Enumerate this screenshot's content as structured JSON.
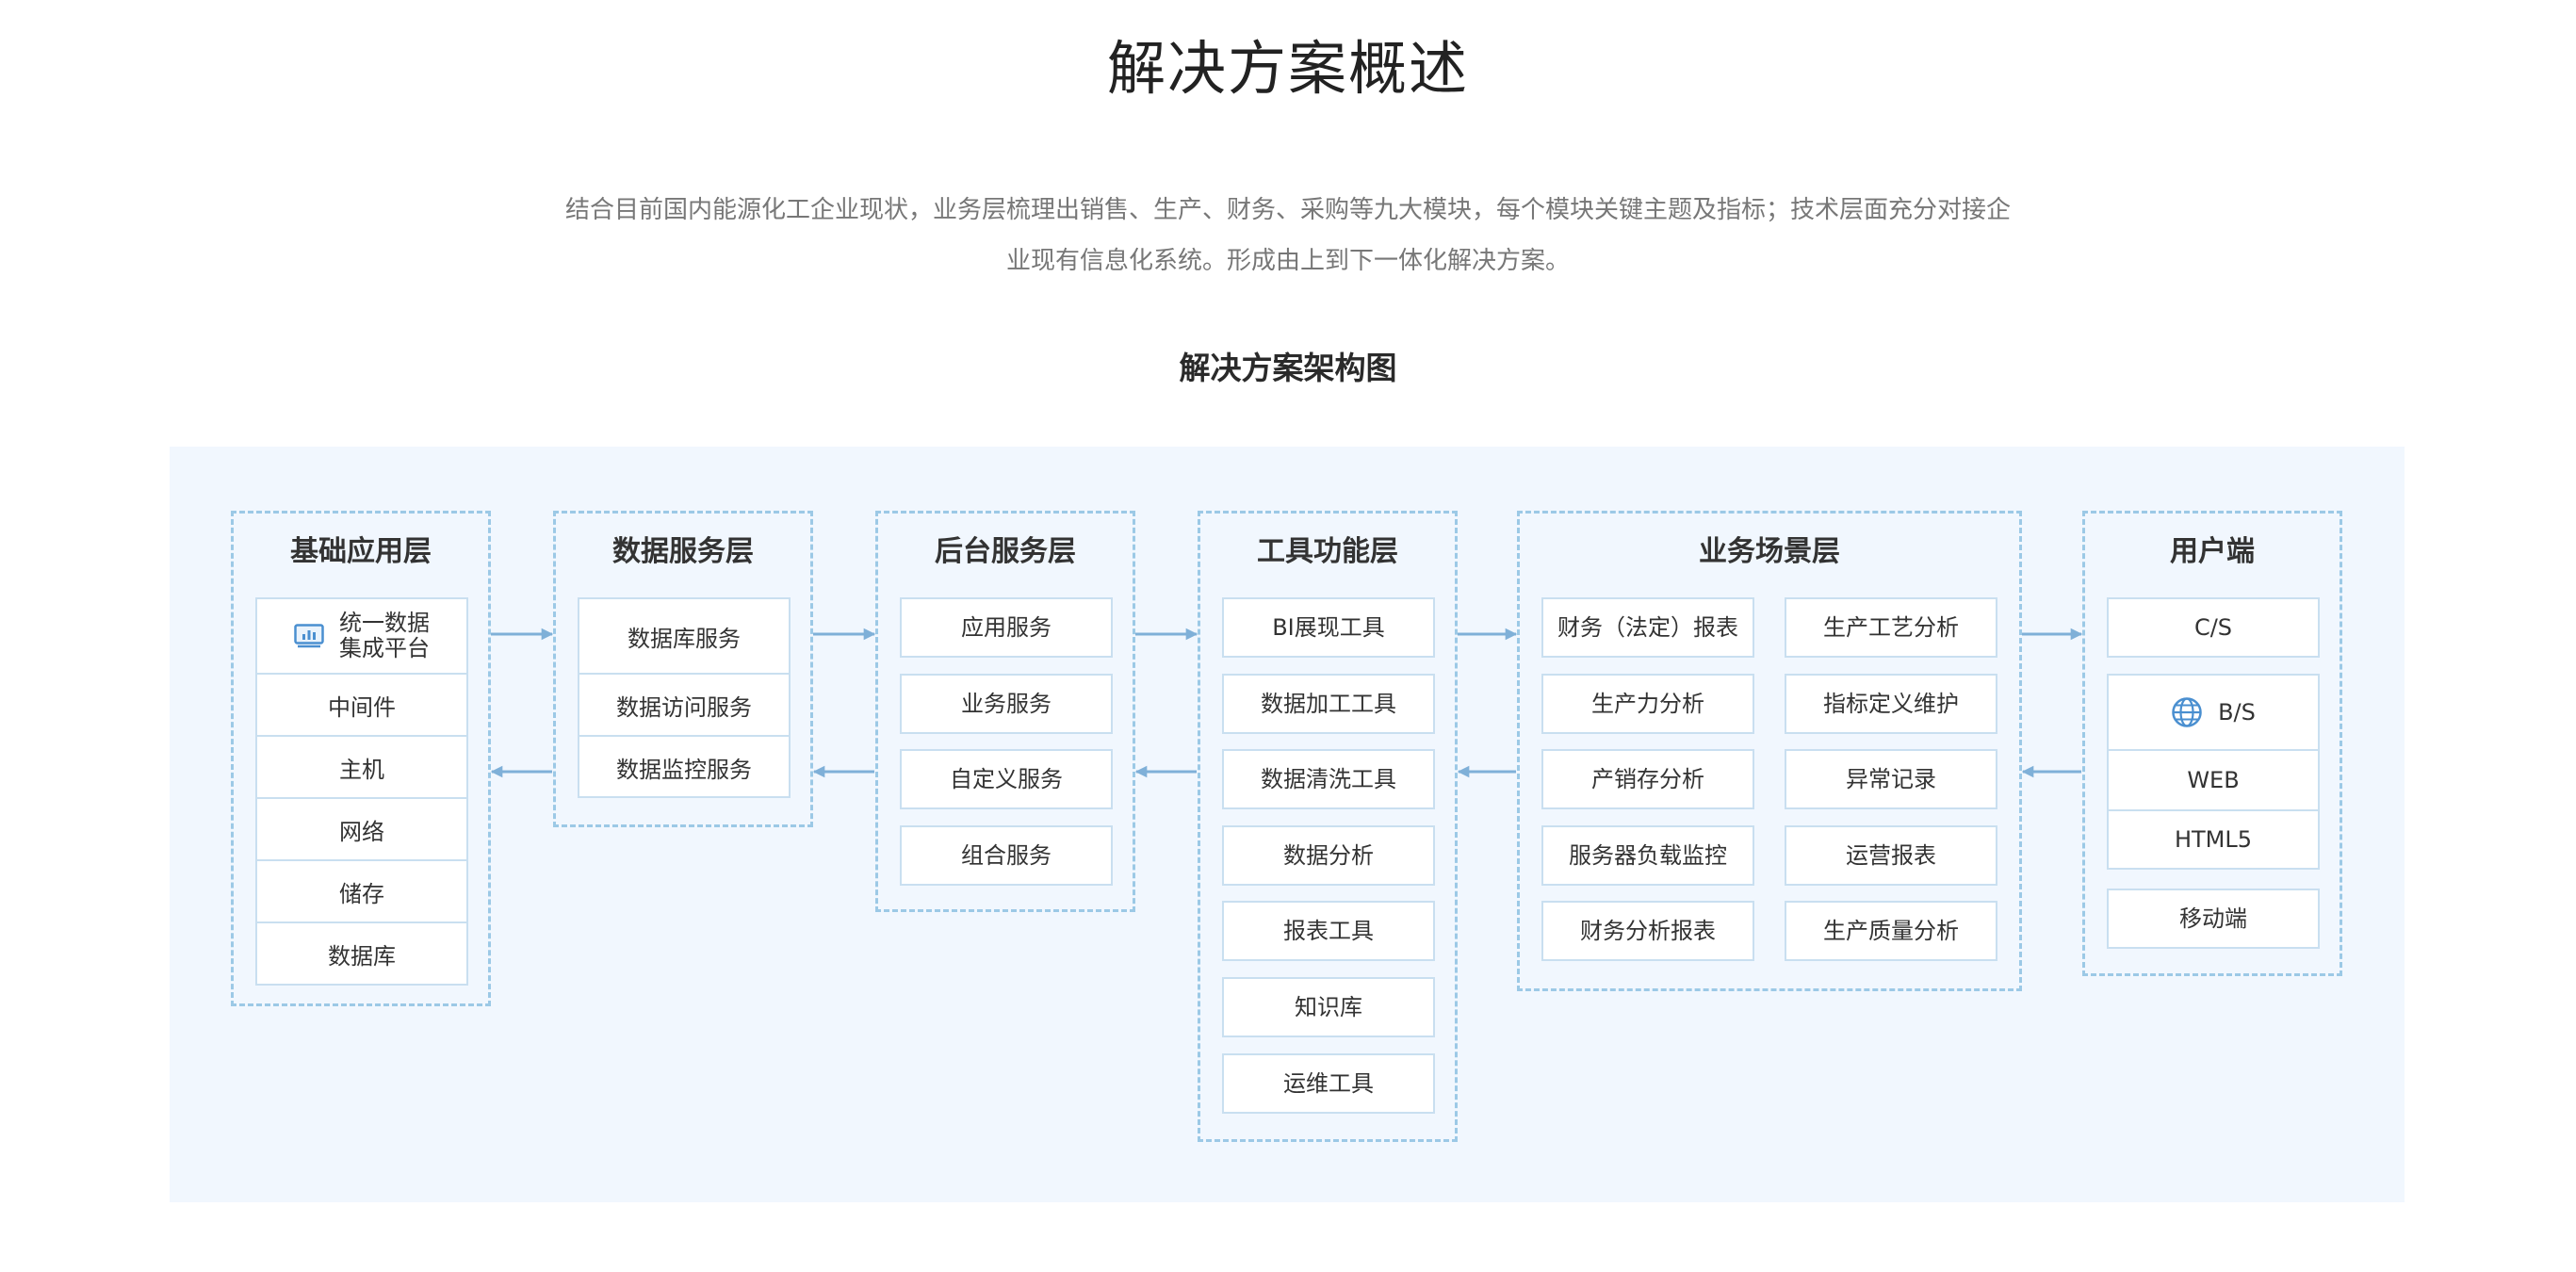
{
  "header": {
    "title": "解决方案概述",
    "intro_line1": "结合目前国内能源化工企业现状，业务层梳理出销售、生产、财务、采购等九大模块，每个模块关键主题及指标；技术层面充分对接企",
    "intro_line2": "业现有信息化系统。形成由上到下一体化解决方案。"
  },
  "diagram": {
    "title": "解决方案架构图",
    "colors": {
      "panel_bg": "#f1f7fe",
      "dashed_border": "#9cc9e6",
      "box_border": "#c9dff0",
      "arrow": "#7fb0d8",
      "icon": "#4a8fd0"
    },
    "layers": {
      "base": {
        "title": "基础应用层",
        "platform_line1": "统一数据",
        "platform_line2": "集成平台",
        "platform_icon": "chart-icon",
        "items": [
          "中间件",
          "主机",
          "网络",
          "储存",
          "数据库"
        ]
      },
      "data_service": {
        "title": "数据服务层",
        "items": [
          "数据库服务",
          "数据访问服务",
          "数据监控服务"
        ]
      },
      "backend": {
        "title": "后台服务层",
        "items": [
          "应用服务",
          "业务服务",
          "自定义服务",
          "组合服务"
        ]
      },
      "tools": {
        "title": "工具功能层",
        "items": [
          "BI展现工具",
          "数据加工工具",
          "数据清洗工具",
          "数据分析",
          "报表工具",
          "知识库",
          "运维工具"
        ]
      },
      "business": {
        "title": "业务场景层",
        "left": [
          "财务（法定）报表",
          "生产力分析",
          "产销存分析",
          "服务器负载监控",
          "财务分析报表"
        ],
        "right": [
          "生产工艺分析",
          "指标定义维护",
          "异常记录",
          "运营报表",
          "生产质量分析"
        ]
      },
      "client": {
        "title": "用户端",
        "cs": "C/S",
        "bs": "B/S",
        "bs_icon": "globe-icon",
        "web": "WEB",
        "html5": "HTML5",
        "mobile": "移动端"
      }
    }
  }
}
